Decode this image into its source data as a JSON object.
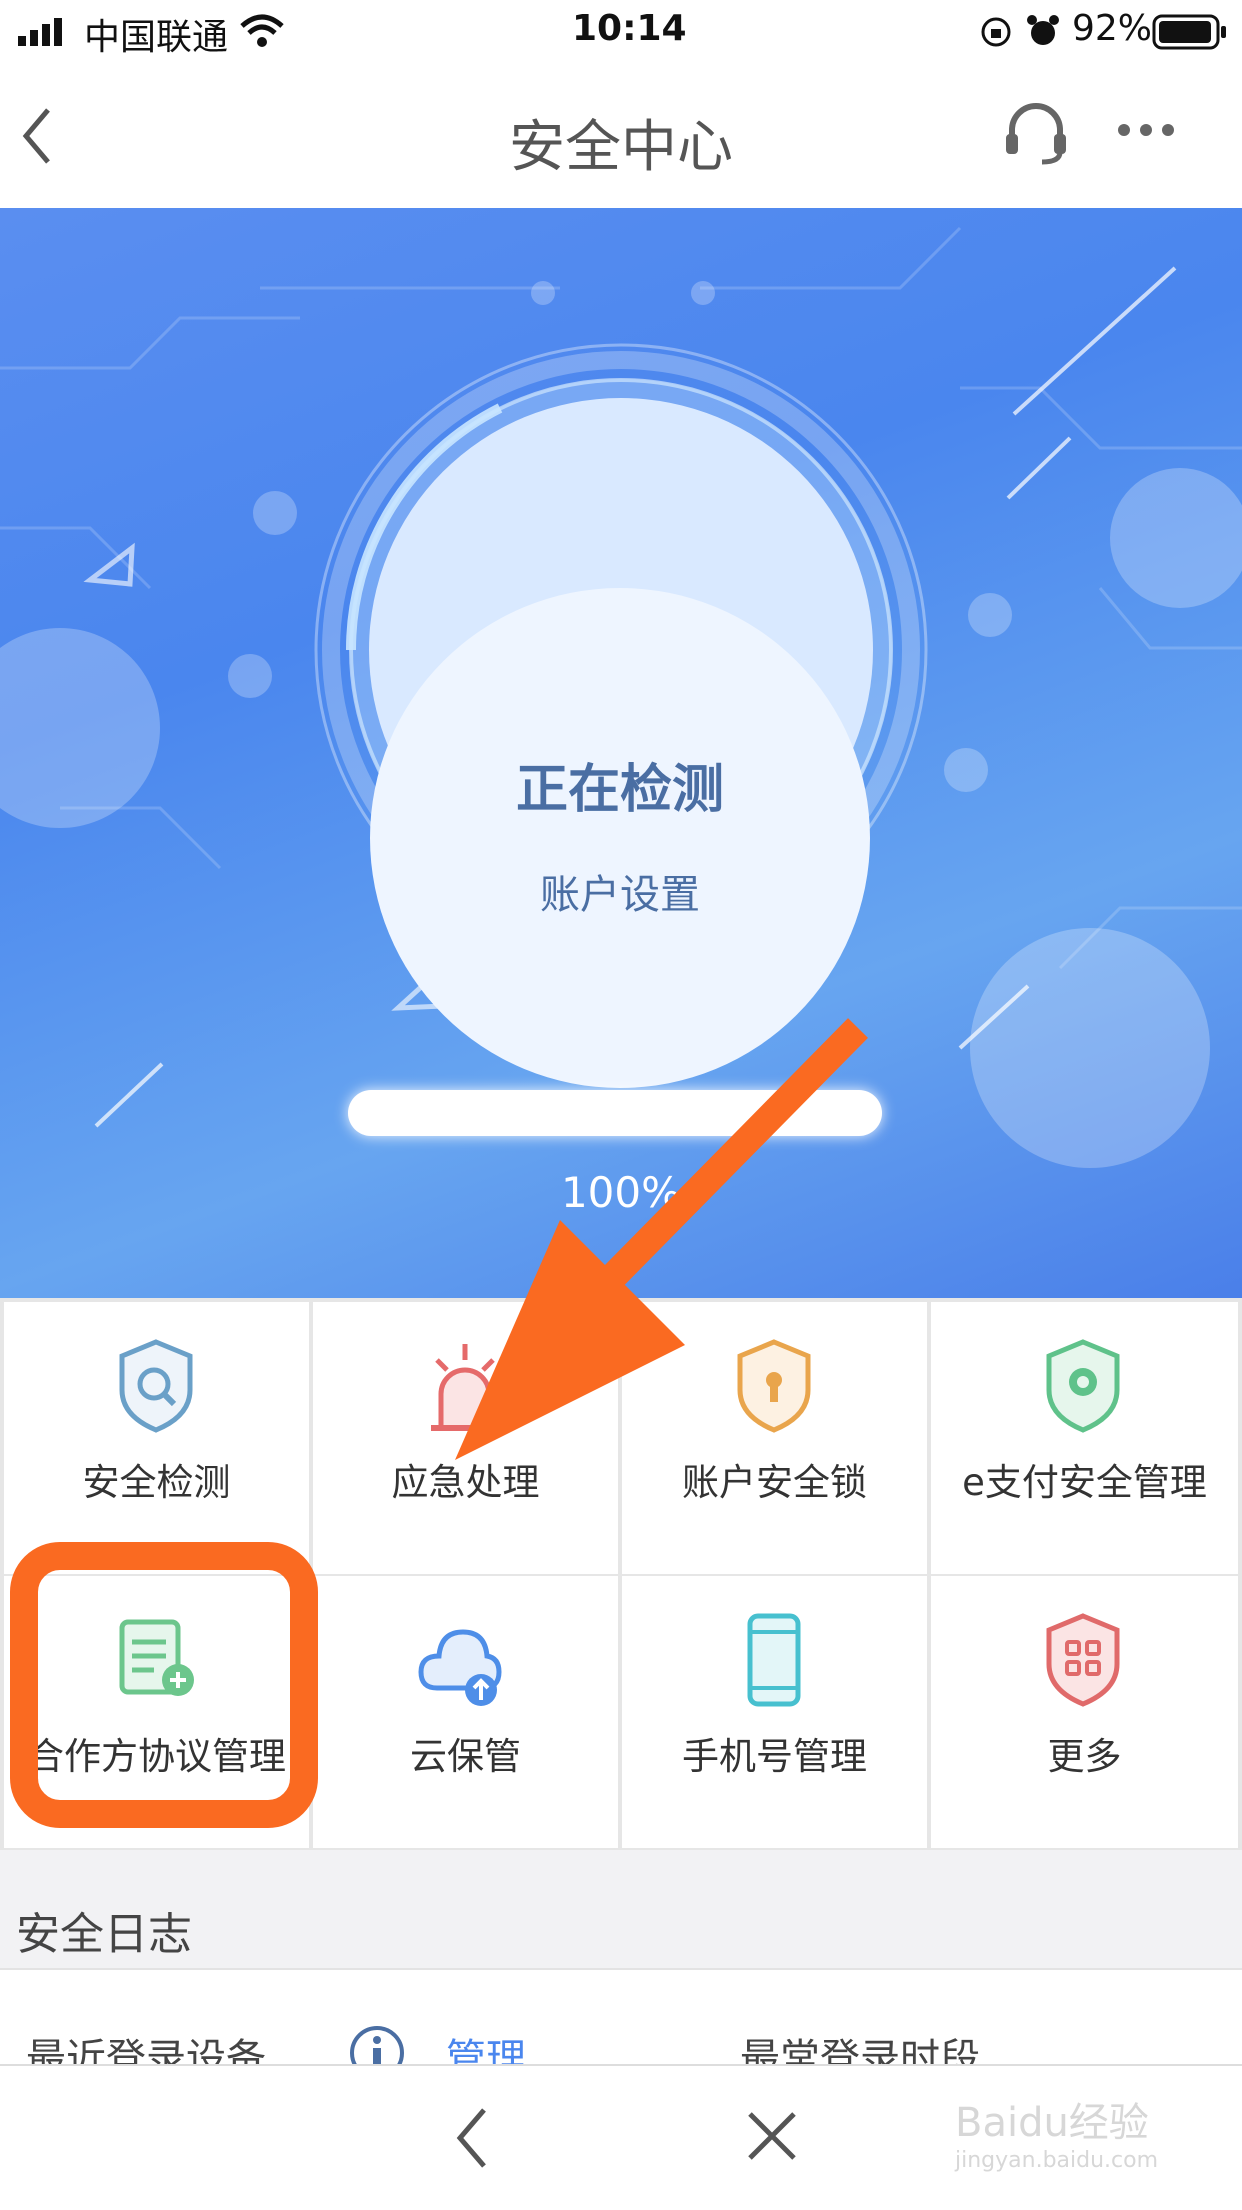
{
  "status_bar": {
    "carrier": "中国联通",
    "time": "10:14",
    "battery": "92%"
  },
  "nav": {
    "title": "安全中心",
    "icons": [
      "back-chevron-icon",
      "headset-icon",
      "more-dots-icon"
    ]
  },
  "scan": {
    "status": "正在检测",
    "item": "账户设置",
    "progress": 1.0,
    "progress_text": "100%"
  },
  "grid": {
    "items": [
      {
        "label": "安全检测",
        "icon": "search-shield-icon",
        "color": "#6aa0c8"
      },
      {
        "label": "应急处理",
        "icon": "alarm-light-icon",
        "color": "#e56a6a"
      },
      {
        "label": "账户安全锁",
        "icon": "lock-shield-icon",
        "color": "#e9a54c"
      },
      {
        "label": "e支付安全管理",
        "icon": "gear-shield-icon",
        "color": "#5fc28a"
      },
      {
        "label": "合作方协议管理",
        "icon": "document-add-icon",
        "color": "#6cc68c"
      },
      {
        "label": "云保管",
        "icon": "cloud-upload-icon",
        "color": "#4e8ee8"
      },
      {
        "label": "手机号管理",
        "icon": "phone-icon",
        "color": "#47c0cf"
      },
      {
        "label": "更多",
        "icon": "more-grid-icon",
        "color": "#e06a6a"
      }
    ]
  },
  "log": {
    "section_title": "安全日志",
    "recent_device": "最近登录设备",
    "manage": "管理",
    "common_time": "最常登录时段"
  },
  "bottom_nav": {
    "icons": [
      "back-chevron-icon",
      "close-icon"
    ]
  },
  "annotation": {
    "color": "#fa6a21"
  },
  "watermark": {
    "main": "Baidu经验",
    "sub": "jingyan.baidu.com"
  }
}
